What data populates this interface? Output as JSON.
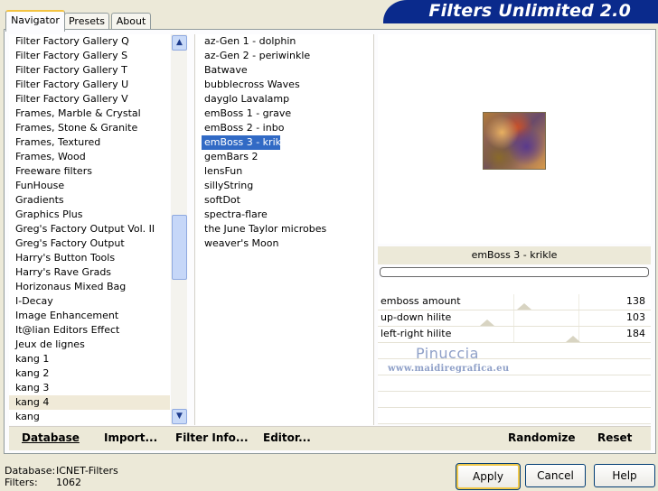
{
  "tabs": [
    "Navigator",
    "Presets",
    "About"
  ],
  "banner_title": "Filters Unlimited 2.0",
  "categories": [
    "Filter Factory Gallery Q",
    "Filter Factory Gallery S",
    "Filter Factory Gallery T",
    "Filter Factory Gallery U",
    "Filter Factory Gallery V",
    "Frames, Marble & Crystal",
    "Frames, Stone & Granite",
    "Frames, Textured",
    "Frames, Wood",
    "Freeware filters",
    "FunHouse",
    "Gradients",
    "Graphics Plus",
    "Greg's Factory Output Vol. II",
    "Greg's Factory Output",
    "Harry's Button Tools",
    "Harry's Rave Grads",
    "Horizonaus Mixed Bag",
    "I-Decay",
    "Image Enhancement",
    "It@lian Editors Effect",
    "Jeux de lignes",
    "kang 1",
    "kang 2",
    "kang 3",
    "kang 4",
    "kang"
  ],
  "selected_category": "kang 4",
  "filters": [
    "az-Gen 1  -  dolphin",
    "az-Gen 2  -  periwinkle",
    "Batwave",
    "bubblecross Waves",
    "dayglo Lavalamp",
    "emBoss 1  -  grave",
    "emBoss 2  -  inbo",
    "emBoss 3  -  krikle",
    "gemBars 2",
    "lensFun",
    "sillyString",
    "softDot",
    "spectra-flare",
    "the June Taylor microbes",
    "weaver's Moon"
  ],
  "selected_filter": "emBoss 3  -  krikle",
  "preview_filter_name": "emBoss 3  -  krikle",
  "controls": [
    {
      "label": "emboss amount",
      "value": "138",
      "level": 138
    },
    {
      "label": "up-down hilite",
      "value": "103",
      "level": 103
    },
    {
      "label": "left-right hilite",
      "value": "184",
      "level": 184
    }
  ],
  "watermark": {
    "name": "Pinuccia",
    "url": "www.maidiregrafica.eu"
  },
  "left_buttons": [
    "Database",
    "Import...",
    "Filter Info...",
    "Editor..."
  ],
  "right_buttons": [
    "Randomize",
    "Reset"
  ],
  "status": {
    "database_label": "Database:",
    "database_value": "ICNET-Filters",
    "filters_label": "Filters:",
    "filters_value": "1062"
  },
  "dialog_buttons": {
    "apply": "Apply",
    "cancel": "Cancel",
    "help": "Help"
  },
  "scroll_arrows": {
    "up": "▲",
    "down": "▼"
  }
}
